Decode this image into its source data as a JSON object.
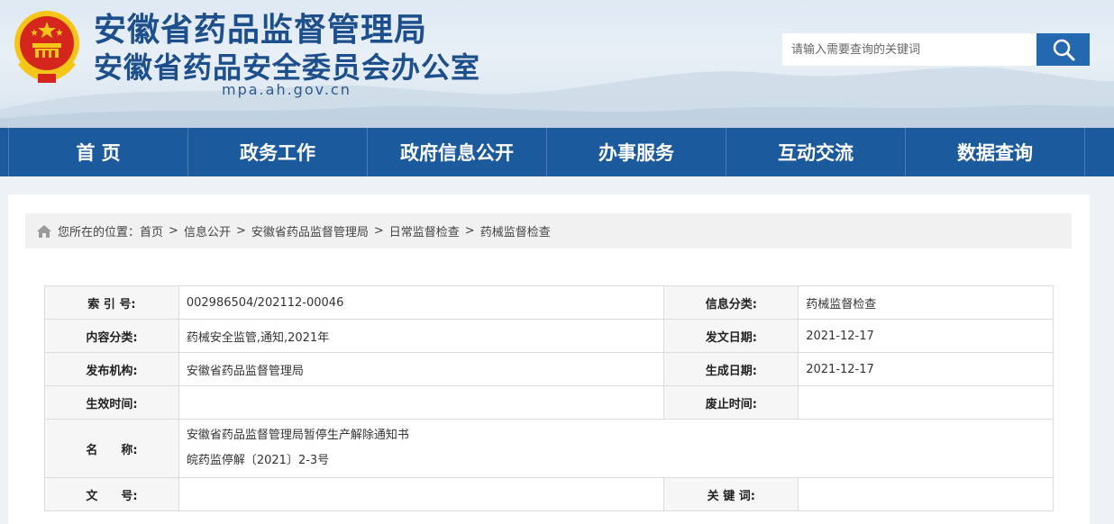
{
  "header": {
    "title_line1": "安徽省药品监督管理局",
    "title_line2": "安徽省药品安全委员会办公室",
    "domain": "mpa.ah.gov.cn",
    "search_placeholder": "请输入需要查询的关键词"
  },
  "nav": {
    "items": [
      {
        "label": "首 页"
      },
      {
        "label": "政务工作"
      },
      {
        "label": "政府信息公开"
      },
      {
        "label": "办事服务"
      },
      {
        "label": "互动交流"
      },
      {
        "label": "数据查询"
      }
    ]
  },
  "breadcrumb": {
    "prefix": "您所在的位置：",
    "items": [
      "首页",
      "信息公开",
      "安徽省药品监督管理局",
      "日常监督检查",
      "药械监督检查"
    ],
    "separator": ">"
  },
  "info": {
    "index_label": "索 引 号:",
    "index_value": "002986504/202112-00046",
    "info_category_label": "信息分类:",
    "info_category_value": "药械监督检查",
    "content_category_label": "内容分类:",
    "content_category_value": "药械安全监管,通知,2021年",
    "issue_date_label": "发文日期:",
    "issue_date_value": "2021-12-17",
    "publisher_label": "发布机构:",
    "publisher_value": "安徽省药品监督管理局",
    "generated_date_label": "生成日期:",
    "generated_date_value": "2021-12-17",
    "effective_label": "生效时间:",
    "effective_value": "",
    "expiry_label": "废止时间:",
    "expiry_value": "",
    "name_label": "名　　称:",
    "name_line1": "安徽省药品监督管理局暂停生产解除通知书",
    "name_line2": "皖药监停解〔2021〕2-3号",
    "doc_no_label": "文　　号:",
    "doc_no_value": "",
    "keywords_label": "关 键 词:",
    "keywords_value": ""
  },
  "colors": {
    "nav_bg": "#1c5a9e",
    "title": "#1d4f8c",
    "search_btn": "#2468b0",
    "emblem_red": "#d4261c",
    "emblem_gold": "#f5c518"
  }
}
